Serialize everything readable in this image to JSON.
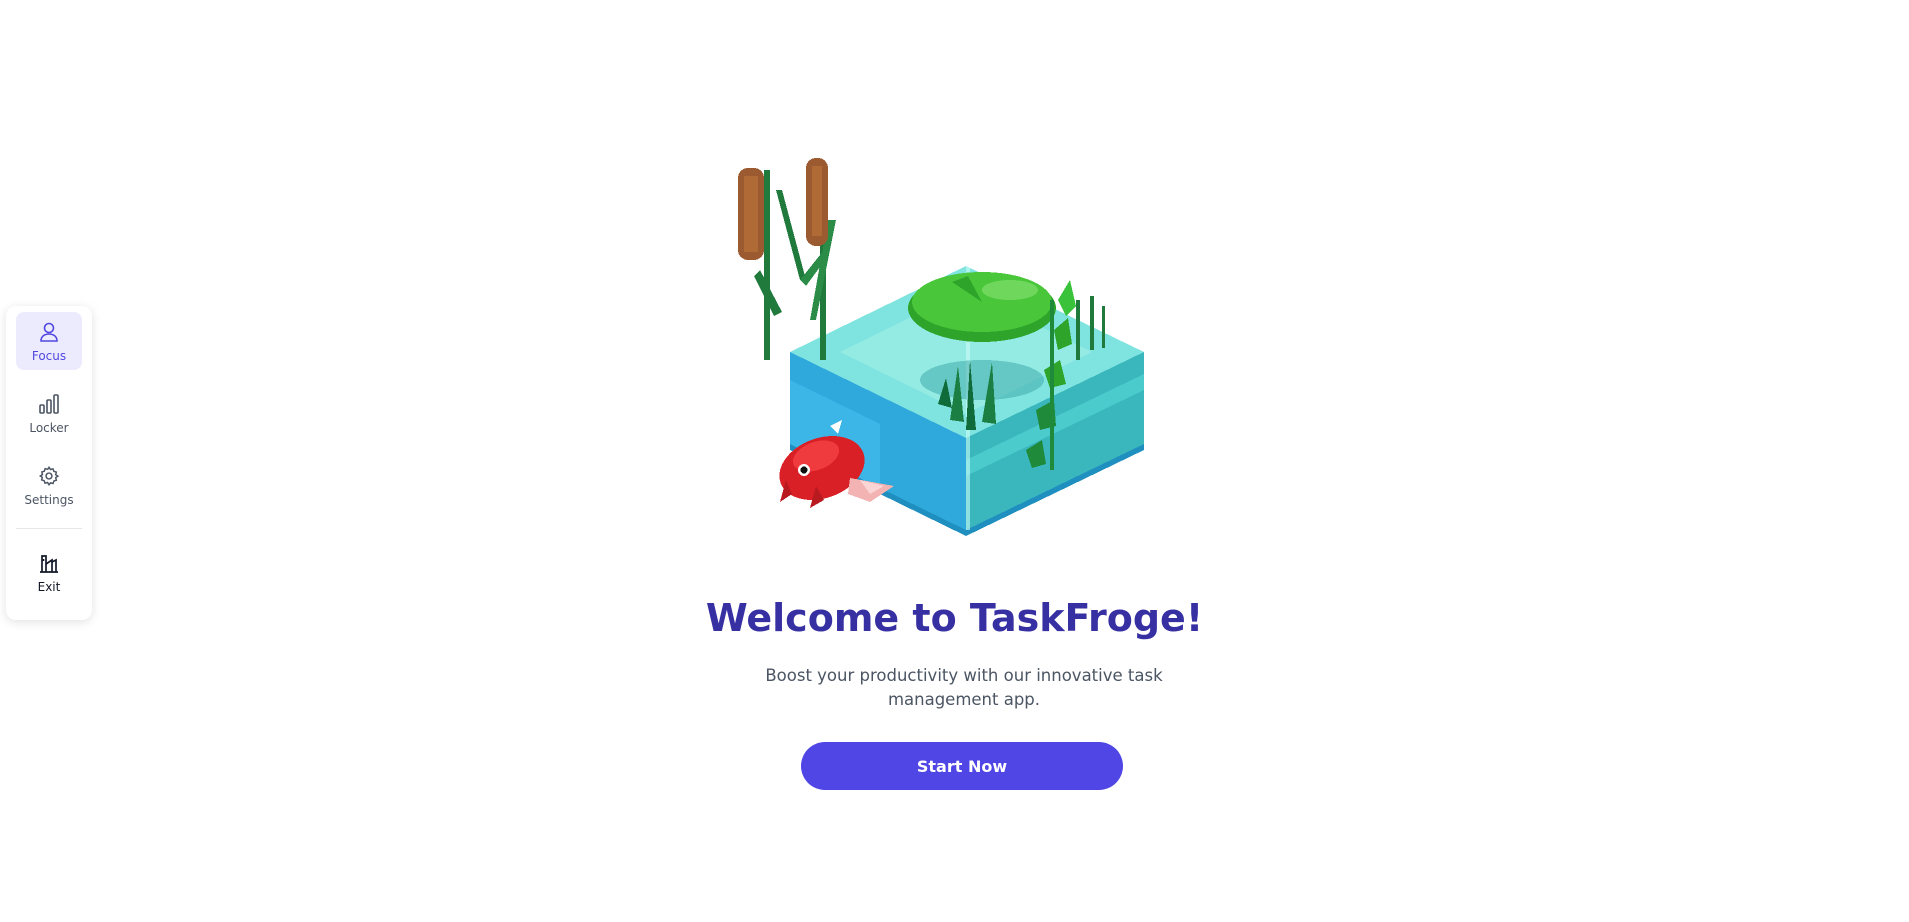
{
  "sidebar": {
    "items": [
      {
        "label": "Focus",
        "icon": "user-icon",
        "active": true
      },
      {
        "label": "Locker",
        "icon": "bar-chart-icon",
        "active": false
      },
      {
        "label": "Settings",
        "icon": "gear-icon",
        "active": false
      }
    ],
    "exit": {
      "label": "Exit",
      "icon": "exit-building-icon"
    }
  },
  "main": {
    "title": "Welcome to TaskFroge!",
    "subtitle": "Boost your productivity with our innovative task management app.",
    "cta_label": "Start Now",
    "illustration": "pixel-art-pond-icon"
  },
  "colors": {
    "accent": "#4f46e5",
    "title": "#3730a3",
    "active_bg": "#ecebfd",
    "active_fg": "#5147e0"
  }
}
